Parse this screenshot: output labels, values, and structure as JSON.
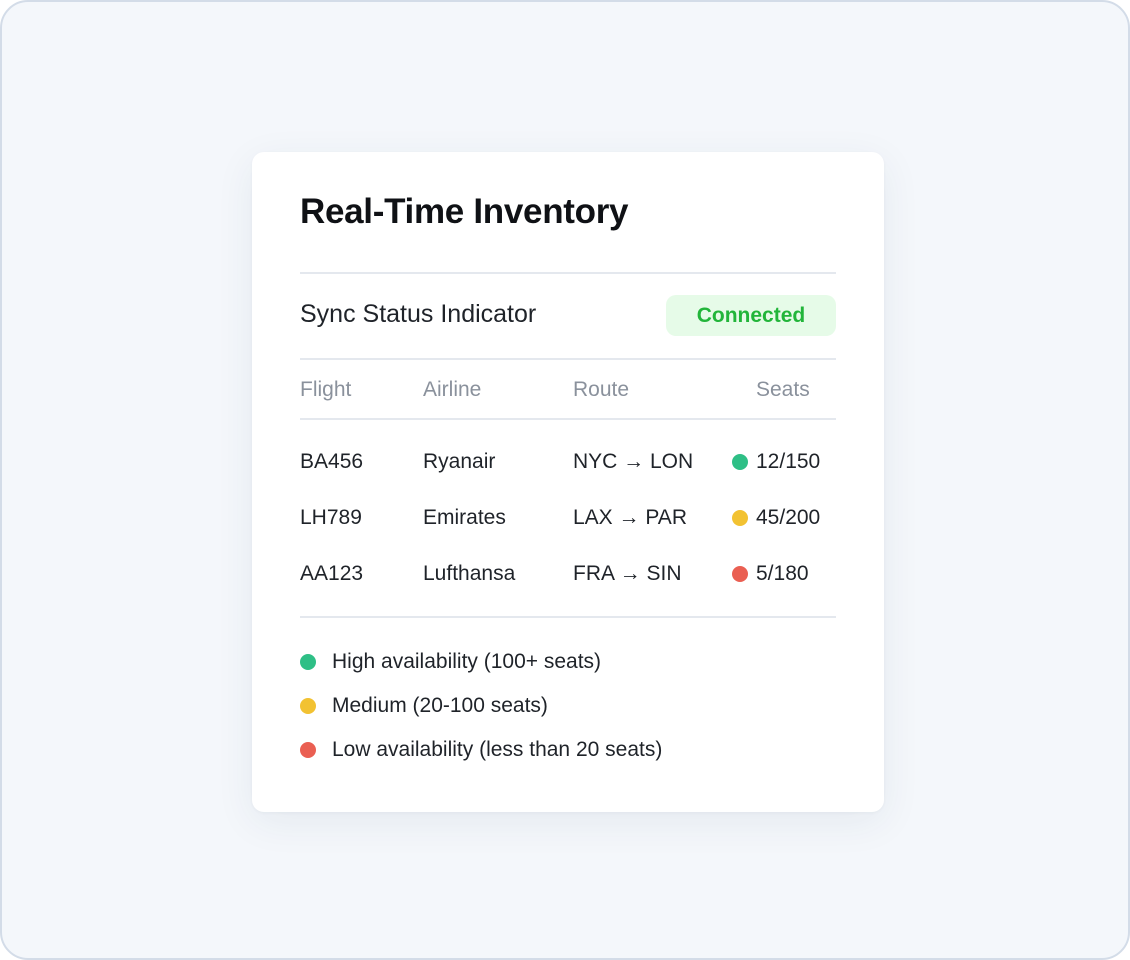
{
  "card": {
    "title": "Real-Time Inventory",
    "sync_label": "Sync Status Indicator",
    "sync_status": "Connected"
  },
  "table": {
    "headers": [
      "Flight",
      "Airline",
      "Route",
      "Seats"
    ],
    "rows": [
      {
        "flight": "BA456",
        "airline": "Ryanair",
        "route": "NYC → LON",
        "seats": "12/150",
        "level": "high"
      },
      {
        "flight": "LH789",
        "airline": "Emirates",
        "route": "LAX → PAR",
        "seats": "45/200",
        "level": "medium"
      },
      {
        "flight": "AA123",
        "airline": "Lufthansa",
        "route": "FRA → SIN",
        "seats": "5/180",
        "level": "low"
      }
    ]
  },
  "legend": [
    {
      "level": "high",
      "label": "High availability (100+ seats)"
    },
    {
      "level": "medium",
      "label": "Medium (20-100 seats)"
    },
    {
      "level": "low",
      "label": "Low availability (less than 20 seats)"
    }
  ],
  "colors": {
    "high": "#2ebf86",
    "medium": "#f2c232",
    "low": "#ea5f52",
    "status_text": "#22b53a",
    "status_bg": "#e6fbe8"
  }
}
